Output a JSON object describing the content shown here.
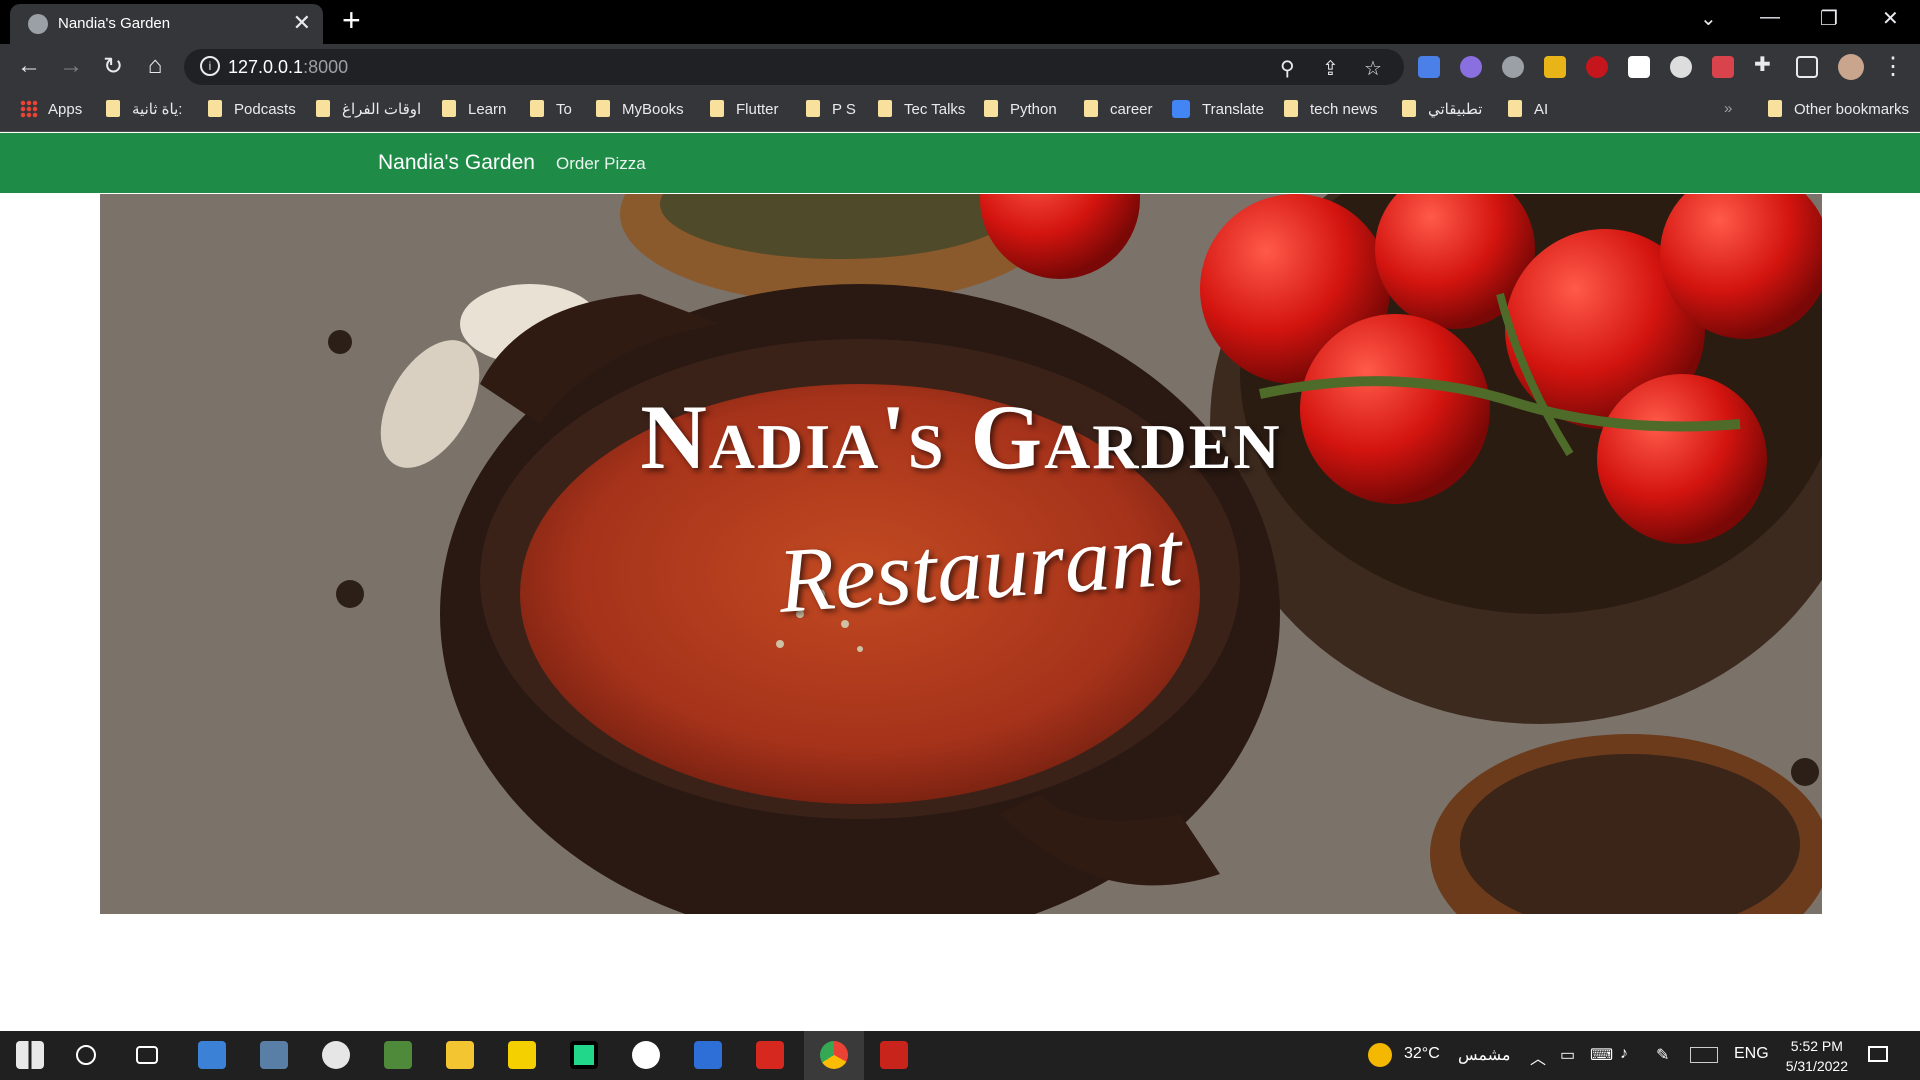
{
  "browser": {
    "tab_title": "Nandia's Garden",
    "url_host": "127.0.0.1",
    "url_port": ":8000",
    "bookmarks": [
      {
        "label": "Apps",
        "icon": "apps-grid-icon"
      },
      {
        "label": "ياة ثانية:",
        "icon": "folder-icon"
      },
      {
        "label": "Podcasts",
        "icon": "folder-icon"
      },
      {
        "label": "اوقات الفراغ",
        "icon": "folder-icon"
      },
      {
        "label": "Learn",
        "icon": "folder-icon"
      },
      {
        "label": "To",
        "icon": "folder-icon"
      },
      {
        "label": "MyBooks",
        "icon": "folder-icon"
      },
      {
        "label": "Flutter",
        "icon": "folder-icon"
      },
      {
        "label": "P S",
        "icon": "folder-icon"
      },
      {
        "label": "Tec Talks",
        "icon": "folder-icon"
      },
      {
        "label": "Python",
        "icon": "folder-icon"
      },
      {
        "label": "career",
        "icon": "folder-icon"
      },
      {
        "label": "Translate",
        "icon": "google-translate-icon"
      },
      {
        "label": "tech news",
        "icon": "folder-icon"
      },
      {
        "label": "تطبيقاتي",
        "icon": "folder-icon"
      },
      {
        "label": "AI",
        "icon": "folder-icon"
      }
    ],
    "other_bookmarks": "Other bookmarks",
    "overflow": "»"
  },
  "site": {
    "brand": "Nandia's Garden",
    "nav_link": "Order Pizza",
    "brand_color": "#1e8b47",
    "hero_title": "Nadia's Garden",
    "hero_subtitle": "Restaurant"
  },
  "taskbar": {
    "weather_temp": "32°C",
    "weather_text": "مشمس",
    "language": "ENG",
    "time": "5:52 PM",
    "date": "5/31/2022"
  }
}
